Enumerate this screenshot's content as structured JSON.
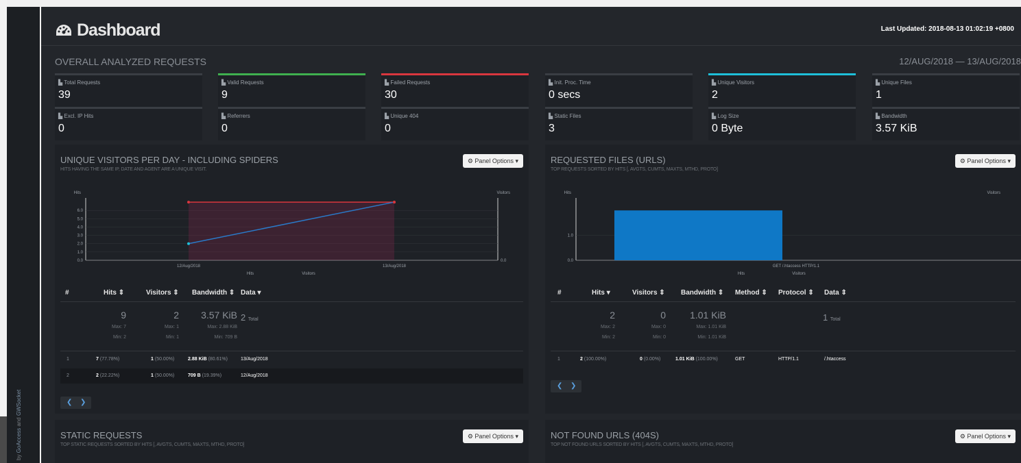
{
  "sidebar": {
    "credit_by": "by",
    "credit_goaccess": "GoAccess",
    "credit_and": "and",
    "credit_gwsocket": "GWSocket"
  },
  "header": {
    "title": "Dashboard",
    "last_updated_label": "Last Updated:",
    "last_updated_value": "2018-08-13 01:02:19 +0800"
  },
  "overall": {
    "title": "OVERALL ANALYZED REQUESTS",
    "date_range": "12/AUG/2018 — 13/AUG/2018"
  },
  "colors": {
    "valid": "#3fb04f",
    "failed": "#d9363e",
    "visitors": "#1ebfd9",
    "bar": "#0f78c6",
    "line_visitors": "#2a79c8",
    "line_hits": "#d9363e"
  },
  "cards": [
    {
      "label": "Total Requests",
      "value": "39"
    },
    {
      "label": "Valid Requests",
      "value": "9"
    },
    {
      "label": "Failed Requests",
      "value": "30"
    },
    {
      "label": "Init. Proc. Time",
      "value": "0 secs"
    },
    {
      "label": "Unique Visitors",
      "value": "2"
    },
    {
      "label": "Unique Files",
      "value": "1"
    },
    {
      "label": "Excl. IP Hits",
      "value": "0"
    },
    {
      "label": "Referrers",
      "value": "0"
    },
    {
      "label": "Unique 404",
      "value": "0"
    },
    {
      "label": "Static Files",
      "value": "3"
    },
    {
      "label": "Log Size",
      "value": "0 Byte"
    },
    {
      "label": "Bandwidth",
      "value": "3.57 KiB"
    }
  ],
  "panel_options": "Panel Options",
  "visitors_panel": {
    "title": "UNIQUE VISITORS PER DAY - INCLUDING SPIDERS",
    "subtitle": "HITS HAVING THE SAME IP, DATE AND AGENT ARE A UNIQUE VISIT.",
    "columns": [
      "#",
      "Hits",
      "Visitors",
      "Bandwidth",
      "Data"
    ],
    "summary": {
      "hits": "9",
      "hits_max": "Max: 7",
      "hits_min": "Min: 2",
      "visitors": "2",
      "visitors_max": "Max: 1",
      "visitors_min": "Min: 1",
      "bw": "3.57 KiB",
      "bw_max": "Max: 2.88 KiB",
      "bw_min": "Min: 709 B",
      "data": "2",
      "data_total": "Total"
    },
    "rows": [
      {
        "n": "1",
        "hits": "7",
        "hits_pct": "(77.78%)",
        "vis": "1",
        "vis_pct": "(50.00%)",
        "bw": "2.88 KiB",
        "bw_pct": "(80.61%)",
        "data": "13/Aug/2018"
      },
      {
        "n": "2",
        "hits": "2",
        "hits_pct": "(22.22%)",
        "vis": "1",
        "vis_pct": "(50.00%)",
        "bw": "709 B",
        "bw_pct": "(19.39%)",
        "data": "12/Aug/2018"
      }
    ]
  },
  "files_panel": {
    "title": "REQUESTED FILES (URLS)",
    "subtitle": "TOP REQUESTS SORTED BY HITS [, AVGTS, CUMTS, MAXTS, MTHD, PROTO]",
    "columns": [
      "#",
      "Hits",
      "Visitors",
      "Bandwidth",
      "Method",
      "Protocol",
      "Data"
    ],
    "summary": {
      "hits": "2",
      "hits_max": "Max: 2",
      "hits_min": "Min: 2",
      "visitors": "0",
      "visitors_max": "Max: 0",
      "visitors_min": "Min: 0",
      "bw": "1.01 KiB",
      "bw_max": "Max: 1.01 KiB",
      "bw_min": "Min: 1.01 KiB",
      "data": "1",
      "data_total": "Total"
    },
    "rows": [
      {
        "n": "1",
        "hits": "2",
        "hits_pct": "(100.00%)",
        "vis": "0",
        "vis_pct": "(0.00%)",
        "bw": "1.01 KiB",
        "bw_pct": "(100.00%)",
        "method": "GET",
        "protocol": "HTTP/1.1",
        "data": "/.htaccess"
      }
    ]
  },
  "static_panel": {
    "title": "STATIC REQUESTS",
    "subtitle": "TOP STATIC REQUESTS SORTED BY HITS [, AVGTS, CUMTS, MAXTS, MTHD, PROTO]"
  },
  "notfound_panel": {
    "title": "NOT FOUND URLS (404S)",
    "subtitle": "TOP NOT FOUND URLS SORTED BY HITS [, AVGTS, CUMTS, MAXTS, MTHD, PROTO]"
  },
  "chart_data": [
    {
      "type": "area",
      "x": [
        "12/Aug/2018",
        "13/Aug/2018"
      ],
      "series": [
        {
          "name": "Hits",
          "values": [
            7,
            7
          ]
        },
        {
          "name": "Visitors",
          "values": [
            2,
            7
          ]
        }
      ],
      "ylabel": "Hits",
      "y2label": "Visitors",
      "yticks": [
        "0.0",
        "1.0",
        "2.0",
        "3.0",
        "4.0",
        "5.0",
        "6.0"
      ],
      "y2ticks": [
        "0.0"
      ],
      "ylim": [
        0,
        7.5
      ],
      "legend": [
        "Hits",
        "Visitors"
      ]
    },
    {
      "type": "bar",
      "categories": [
        "GET /.htaccess HTTP/1.1"
      ],
      "series": [
        {
          "name": "Hits",
          "values": [
            2
          ]
        },
        {
          "name": "Visitors",
          "values": [
            0
          ]
        }
      ],
      "ylabel": "Hits",
      "y2label": "Visitors",
      "yticks": [
        "0.0",
        "1.0"
      ],
      "ylim": [
        0,
        2.5
      ],
      "legend": [
        "Hits",
        "Visitors"
      ]
    }
  ]
}
